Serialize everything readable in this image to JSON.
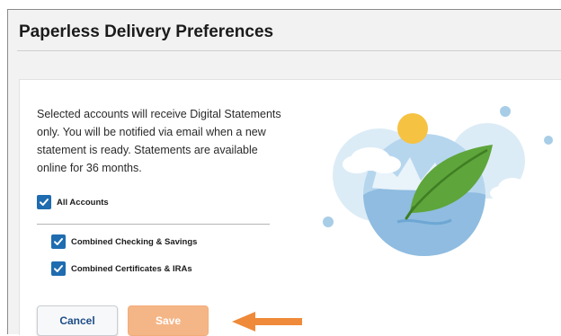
{
  "page": {
    "title": "Paperless Delivery Preferences",
    "description": "Selected accounts will receive Digital Statements only. You will be notified via email when a new statement is ready. Statements are available online for 36 months."
  },
  "checkboxes": [
    {
      "label": "All Accounts",
      "checked": true
    },
    {
      "label": "Combined Checking & Savings",
      "checked": true
    },
    {
      "label": "Combined Certificates & IRAs",
      "checked": true
    }
  ],
  "buttons": {
    "cancel_label": "Cancel",
    "save_label": "Save"
  },
  "colors": {
    "checkbox": "#1f6cb0",
    "cancel_text": "#1c4c86",
    "save_bg": "#f5b687",
    "arrow": "#ef8a3a"
  },
  "icons": {
    "checkmark": "checkmark-icon",
    "arrow": "arrow-left-icon",
    "illustration": "leaf-earth-illustration"
  }
}
